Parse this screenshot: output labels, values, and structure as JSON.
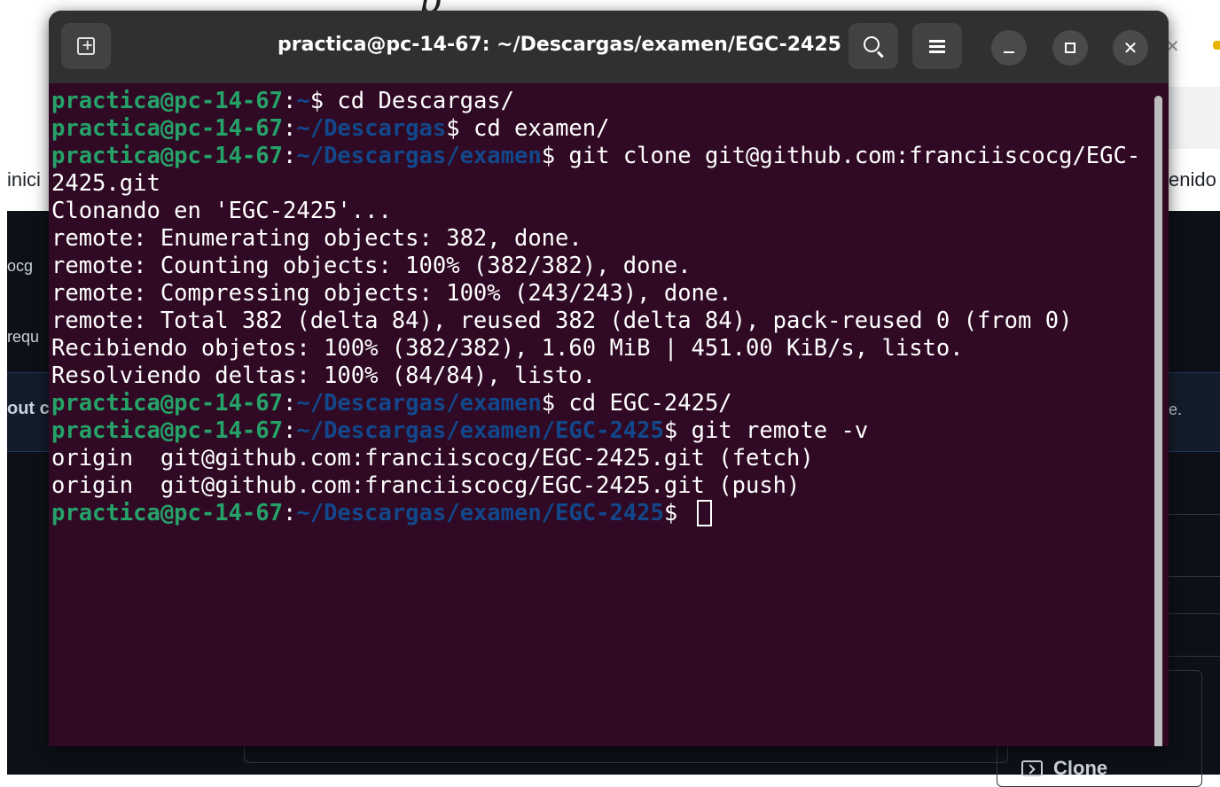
{
  "background": {
    "top_fragment": "p",
    "left_fragments": [
      "inici",
      "ocg",
      "requ",
      "out c"
    ],
    "right_fragments": [
      "enido",
      "e."
    ],
    "clone_button_label": "Clone"
  },
  "terminal": {
    "title": "practica@pc-14-67: ~/Descargas/examen/EGC-2425",
    "user_host": "practica@pc-14-67",
    "lines": [
      {
        "type": "prompt",
        "path": "~",
        "cmd": " cd Descargas/"
      },
      {
        "type": "prompt",
        "path": "~/Descargas",
        "cmd": " cd examen/"
      },
      {
        "type": "prompt",
        "path": "~/Descargas/examen",
        "cmd": " git clone git@github.com:franciiscocg/EGC-"
      },
      {
        "type": "output",
        "text": "2425.git"
      },
      {
        "type": "output",
        "text": "Clonando en 'EGC-2425'..."
      },
      {
        "type": "output",
        "text": "remote: Enumerating objects: 382, done."
      },
      {
        "type": "output",
        "text": "remote: Counting objects: 100% (382/382), done."
      },
      {
        "type": "output",
        "text": "remote: Compressing objects: 100% (243/243), done."
      },
      {
        "type": "output",
        "text": "remote: Total 382 (delta 84), reused 382 (delta 84), pack-reused 0 (from 0)"
      },
      {
        "type": "output",
        "text": "Recibiendo objetos: 100% (382/382), 1.60 MiB | 451.00 KiB/s, listo."
      },
      {
        "type": "output",
        "text": "Resolviendo deltas: 100% (84/84), listo."
      },
      {
        "type": "prompt",
        "path": "~/Descargas/examen",
        "cmd": " cd EGC-2425/"
      },
      {
        "type": "prompt",
        "path": "~/Descargas/examen/EGC-2425",
        "cmd": " git remote -v"
      },
      {
        "type": "output",
        "text": "origin  git@github.com:franciiscocg/EGC-2425.git (fetch)"
      },
      {
        "type": "output",
        "text": "origin  git@github.com:franciiscocg/EGC-2425.git (push)"
      },
      {
        "type": "prompt",
        "path": "~/Descargas/examen/EGC-2425",
        "cmd": " ",
        "cursor": true
      }
    ]
  },
  "colors": {
    "terminal_bg": "#300a24",
    "titlebar_bg": "#303030",
    "prompt_user": "#26a269",
    "prompt_path": "#12488b"
  },
  "icons": [
    "new-tab-icon",
    "search-icon",
    "menu-icon",
    "minimize-icon",
    "maximize-icon",
    "close-icon",
    "terminal-icon"
  ]
}
